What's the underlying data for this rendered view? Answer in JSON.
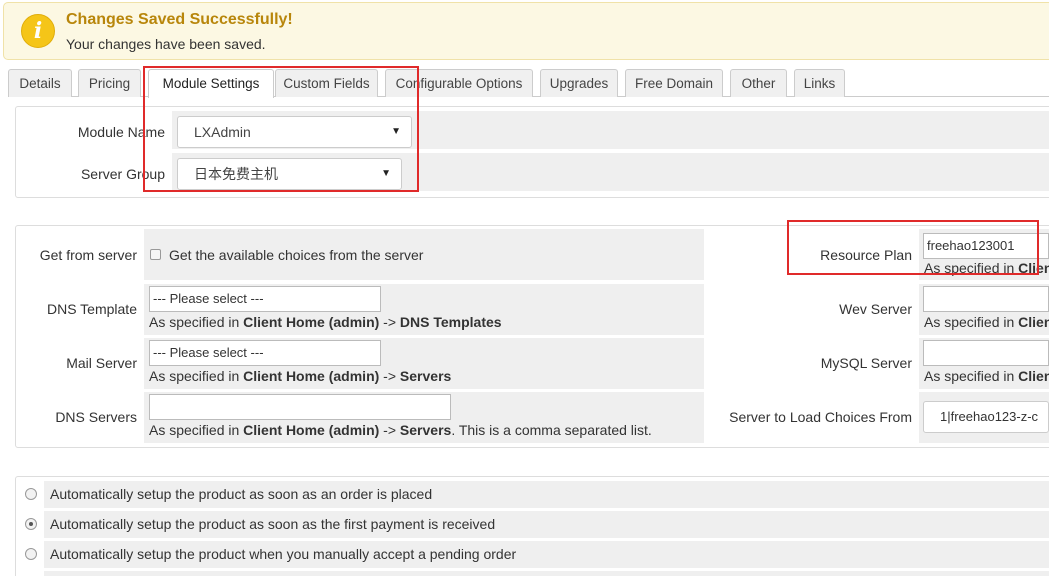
{
  "alert": {
    "icon": "info-icon",
    "icon_glyph": "i",
    "title": "Changes Saved Successfully!",
    "message": "Your changes have been saved."
  },
  "tabs": [
    {
      "label": "Details"
    },
    {
      "label": "Pricing"
    },
    {
      "label": "Module Settings",
      "active": true
    },
    {
      "label": "Custom Fields"
    },
    {
      "label": "Configurable Options"
    },
    {
      "label": "Upgrades"
    },
    {
      "label": "Free Domain"
    },
    {
      "label": "Other"
    },
    {
      "label": "Links"
    }
  ],
  "module": {
    "module_name_label": "Module Name",
    "module_name_value": "LXAdmin",
    "server_group_label": "Server Group",
    "server_group_value": "日本免费主机"
  },
  "config": {
    "get_from_server_label": "Get from server",
    "get_from_server_text": "Get the available choices from the server",
    "resource_plan_label": "Resource Plan",
    "resource_plan_value": "freehao123001",
    "dns_template_label": "DNS Template",
    "dns_template_value": "--- Please select ---",
    "wev_server_label": "Wev Server",
    "wev_server_value": "",
    "mail_server_label": "Mail Server",
    "mail_server_value": "--- Please select ---",
    "mysql_server_label": "MySQL Server",
    "mysql_server_value": "",
    "dns_servers_label": "DNS Servers",
    "dns_servers_value": "",
    "server_to_load_label": "Server to Load Choices From",
    "server_to_load_value": "1|freehao123-z-c",
    "help_prefix": "As specified in ",
    "help_client_home": "Client Home (admin)",
    "help_arrow": " -> ",
    "help_dns_templates": "DNS Templates",
    "help_servers": "Servers",
    "help_comma_list": ". This is a comma separated list.",
    "help_truncated": "Clien"
  },
  "setup": {
    "options": [
      {
        "label": "Automatically setup the product as soon as an order is placed",
        "selected": false
      },
      {
        "label": "Automatically setup the product as soon as the first payment is received",
        "selected": true
      },
      {
        "label": "Automatically setup the product when you manually accept a pending order",
        "selected": false
      }
    ]
  },
  "colors": {
    "highlight": "#e02a2a",
    "alert_bg": "#fcf8e3",
    "alert_title": "#b8860b",
    "label_cell": "#efefef"
  }
}
